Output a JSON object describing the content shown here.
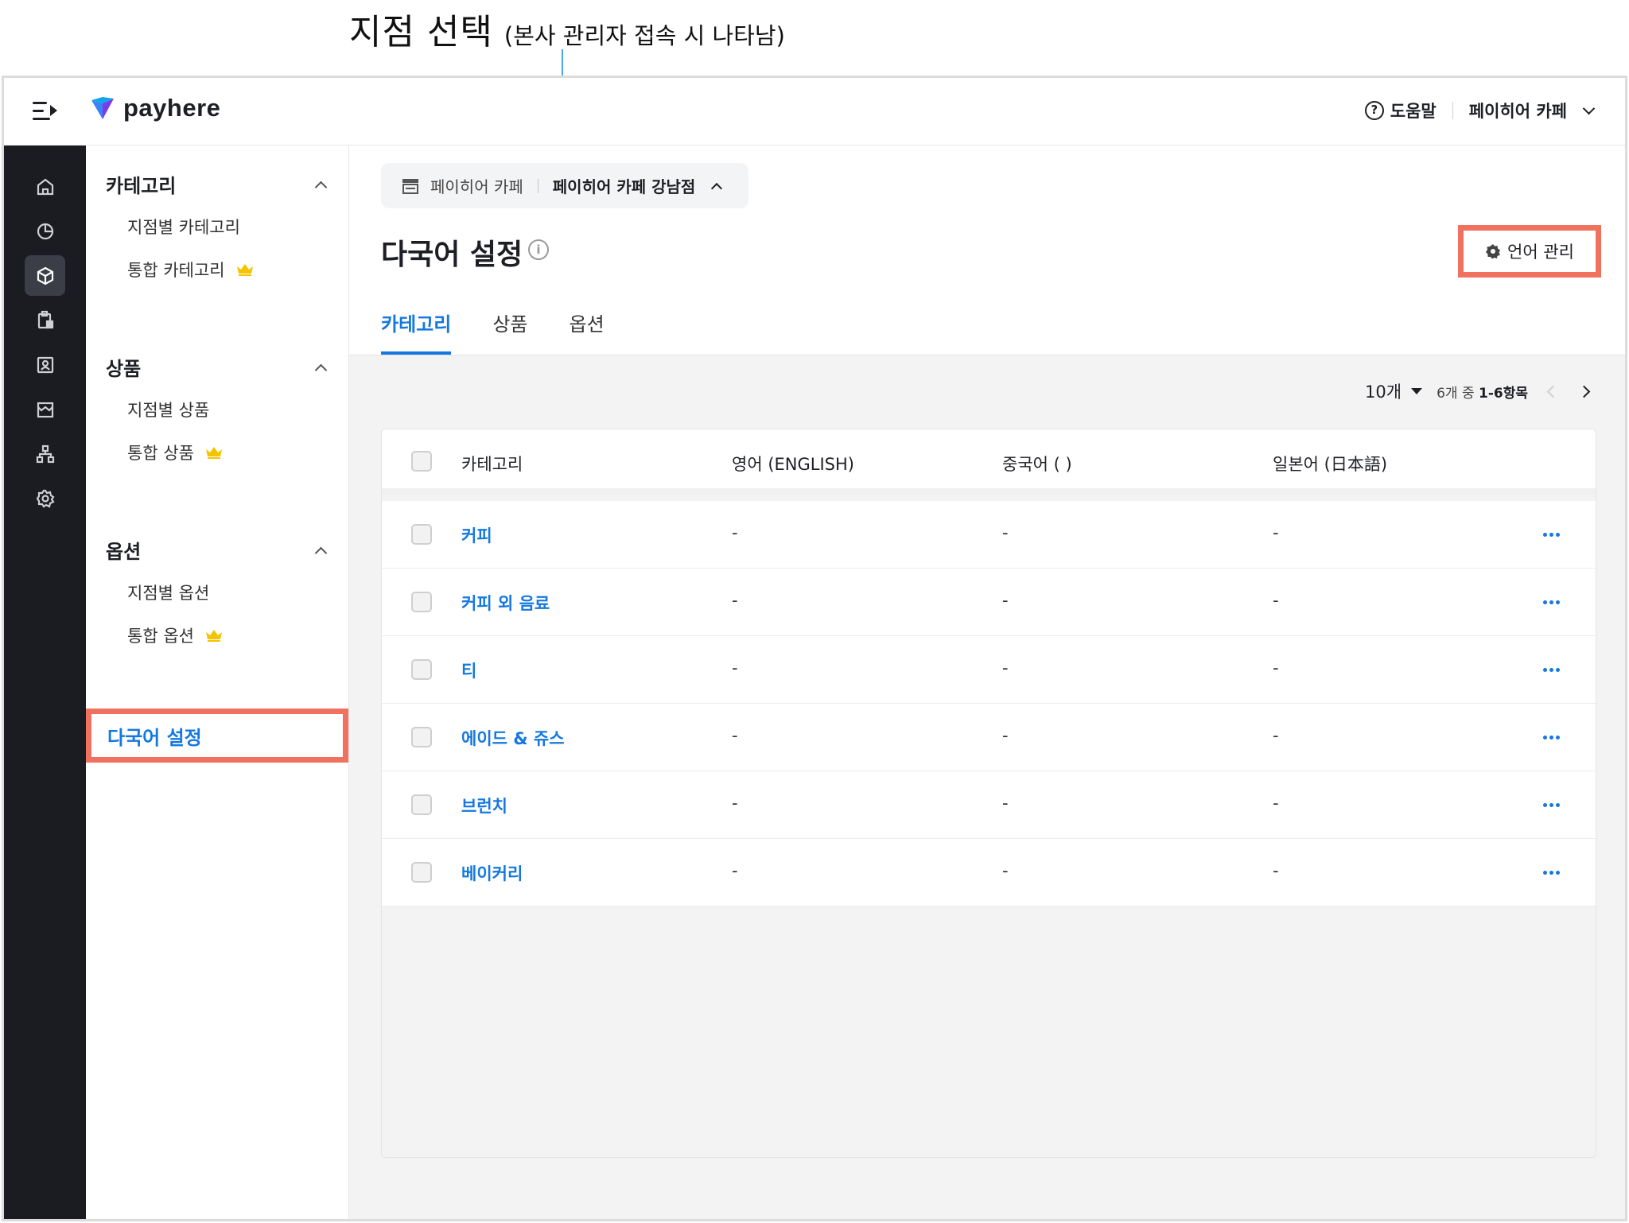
{
  "annotation": {
    "title": "지점 선택",
    "subtitle": "(본사 관리자 접속 시 나타남)"
  },
  "header": {
    "logo_text": "payhere",
    "help_label": "도움말",
    "account_label": "페이히어 카페"
  },
  "rail": {
    "items": [
      "home-icon",
      "chart-icon",
      "box-icon",
      "clipboard-icon",
      "person-card-icon",
      "store-icon",
      "org-chart-icon",
      "gear-icon"
    ],
    "active_index": 2
  },
  "subnav": {
    "groups": [
      {
        "label": "카테고리",
        "items": [
          {
            "label": "지점별 카테고리"
          },
          {
            "label": "통합 카테고리",
            "premium": true
          }
        ]
      },
      {
        "label": "상품",
        "items": [
          {
            "label": "지점별 상품"
          },
          {
            "label": "통합 상품",
            "premium": true
          }
        ]
      },
      {
        "label": "옵션",
        "items": [
          {
            "label": "지점별 옵션"
          },
          {
            "label": "통합 옵션",
            "premium": true
          }
        ]
      }
    ],
    "active_label": "다국어 설정"
  },
  "branch_selector": {
    "hq": "페이히어 카페",
    "branch": "페이히어 카페 강남점"
  },
  "page": {
    "title": "다국어 설정",
    "lang_button": "언어 관리"
  },
  "tabs": [
    "카테고리",
    "상품",
    "옵션"
  ],
  "active_tab": 0,
  "pager": {
    "page_size": "10개",
    "info_prefix": "6개 중",
    "info_range": "1-6항목"
  },
  "table": {
    "headers": [
      "카테고리",
      "영어 (ENGLISH)",
      "중국어 (        )",
      "일본어 (日本語)"
    ],
    "rows": [
      [
        "커피",
        "-",
        "-",
        "-"
      ],
      [
        "커피 외 음료",
        "-",
        "-",
        "-"
      ],
      [
        "티",
        "-",
        "-",
        "-"
      ],
      [
        "에이드 & 쥬스",
        "-",
        "-",
        "-"
      ],
      [
        "브런치",
        "-",
        "-",
        "-"
      ],
      [
        "베이커리",
        "-",
        "-",
        "-"
      ]
    ]
  },
  "colors": {
    "accent": "#1478e0",
    "highlight_border": "#f0715e",
    "annotation_line": "#4aa8e8",
    "rail_bg": "#1b1c22",
    "crown": "#f5c400"
  }
}
